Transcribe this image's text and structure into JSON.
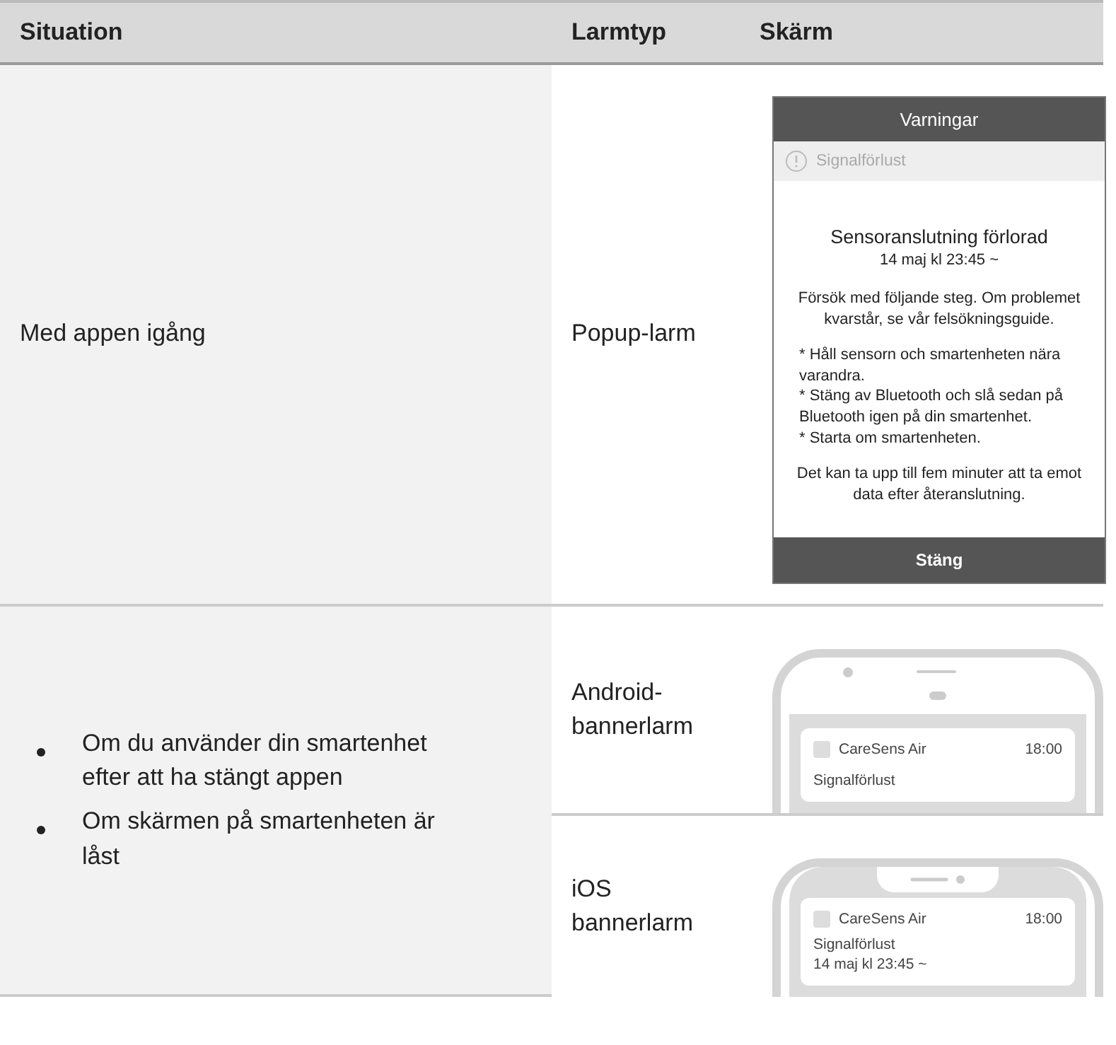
{
  "table": {
    "columns": [
      "Situation",
      "Larmtyp",
      "Skärm"
    ],
    "rows": [
      {
        "situation": {
          "kind": "text",
          "text": "Med appen igång"
        },
        "alarms": [
          {
            "type": "Popup-larm",
            "screen": {
              "kind": "popup",
              "title": "Varningar",
              "alert_label": "Signalförlust",
              "heading": "Sensoranslutning förlorad",
              "time": "14 maj kl 23:45 ~",
              "intro": "Försök med följande steg. Om problemet kvarstår, se vår felsökningsguide.",
              "steps": [
                "* Håll sensorn och smartenheten nära varandra.",
                "* Stäng av Bluetooth och slå sedan på Bluetooth igen på din smartenhet.",
                "* Starta om smartenheten."
              ],
              "note": "Det kan ta upp till fem minuter att ta emot data efter återanslutning.",
              "button": "Stäng"
            }
          }
        ]
      },
      {
        "situation": {
          "kind": "bullets",
          "items": [
            "Om du använder din smartenhet efter att ha stängt appen",
            "Om skärmen på smartenheten är låst"
          ]
        },
        "alarms": [
          {
            "type": "Android-bannerlarm",
            "screen": {
              "kind": "android",
              "app": "CareSens Air",
              "time": "18:00",
              "lines": [
                "Signalförlust"
              ]
            }
          },
          {
            "type": "iOS bannerlarm",
            "screen": {
              "kind": "ios",
              "app": "CareSens Air",
              "time": "18:00",
              "lines": [
                "Signalförlust",
                "14 maj kl 23:45 ~"
              ]
            }
          }
        ]
      }
    ]
  }
}
